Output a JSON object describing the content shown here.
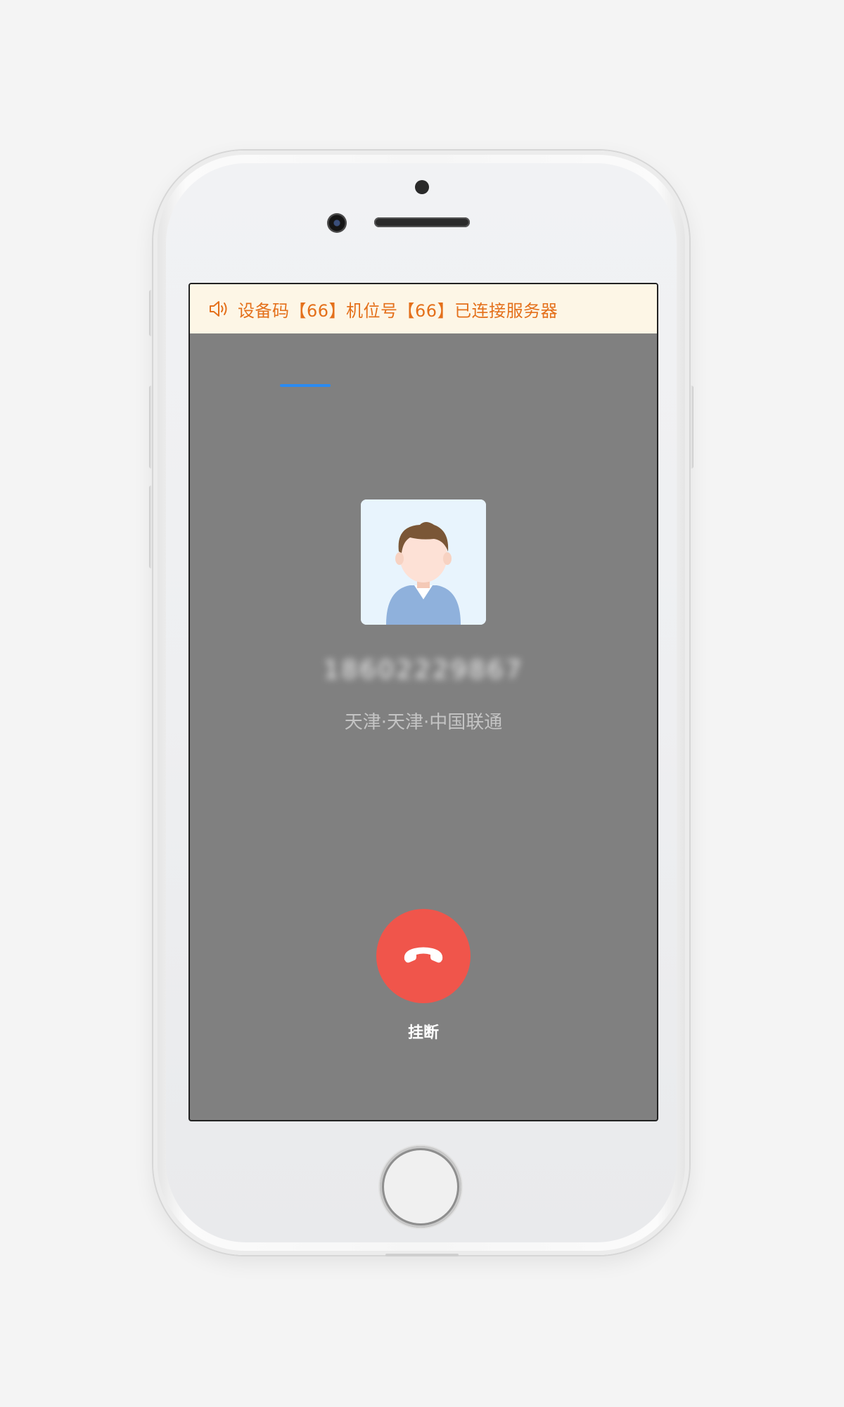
{
  "notice": {
    "icon": "speaker-icon",
    "text": "设备码【66】机位号【66】已连接服务器"
  },
  "call": {
    "avatar": "user-avatar-icon",
    "phone_number": "18602229867",
    "location": "天津·天津·中国联通"
  },
  "hangup": {
    "icon": "hang-up-phone-icon",
    "label": "挂断"
  },
  "colors": {
    "notice_background": "#fdf6e6",
    "notice_text": "#e4701b",
    "screen_background": "#808080",
    "tab_indicator": "#2a8af2",
    "hangup_button": "#f0554b"
  }
}
